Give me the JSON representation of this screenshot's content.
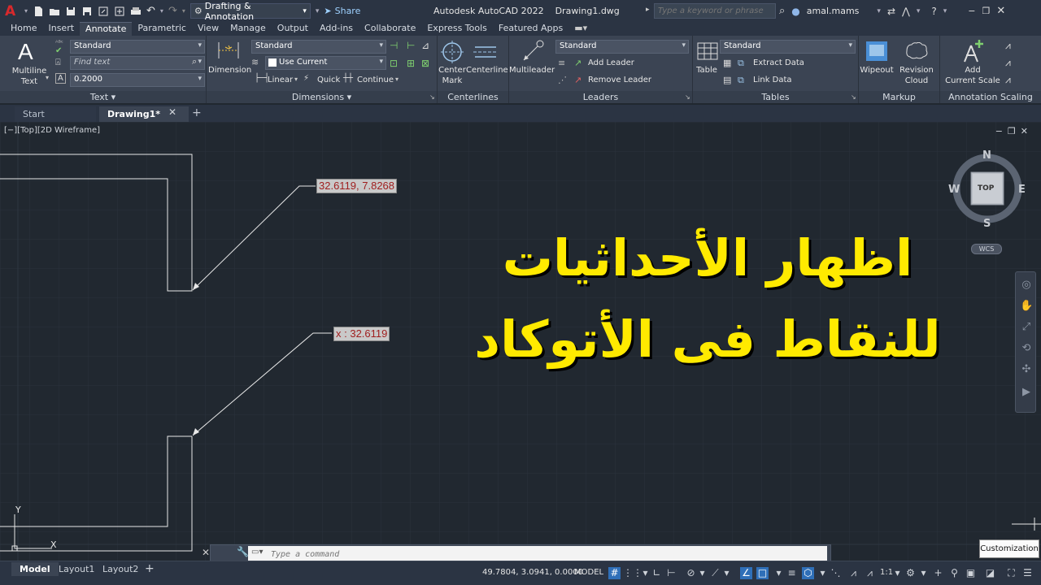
{
  "titlebar": {
    "workspace": "Drafting & Annotation",
    "share_label": "Share",
    "title": "Autodesk AutoCAD 2022    Drawing1.dwg",
    "search_placeholder": "Type a keyword or phrase",
    "user": "amal.mams"
  },
  "ribbon_tabs": [
    "Home",
    "Insert",
    "Annotate",
    "Parametric",
    "View",
    "Manage",
    "Output",
    "Add-ins",
    "Collaborate",
    "Express Tools",
    "Featured Apps"
  ],
  "ribbon_active_tab": "Annotate",
  "panels": {
    "text": {
      "title": "Text",
      "big_button": "Multiline\nText",
      "style": "Standard",
      "find_placeholder": "Find text",
      "height": "0.2000"
    },
    "dimensions": {
      "title": "Dimensions",
      "big_button": "Dimension",
      "style": "Standard",
      "layer": "Use Current",
      "linear": "Linear",
      "quick": "Quick",
      "continue": "Continue"
    },
    "centerlines": {
      "title": "Centerlines",
      "center_mark": "Center\nMark",
      "centerline": "Centerline"
    },
    "leaders": {
      "title": "Leaders",
      "big_button": "Multileader",
      "style": "Standard",
      "add": "Add Leader",
      "remove": "Remove Leader"
    },
    "tables": {
      "title": "Tables",
      "big_button": "Table",
      "style": "Standard",
      "extract": "Extract Data",
      "link": "Link Data"
    },
    "markup": {
      "title": "Markup",
      "wipeout": "Wipeout",
      "revision_cloud": "Revision\nCloud"
    },
    "annotation_scaling": {
      "title": "Annotation Scaling",
      "add_scale": "Add\nCurrent Scale"
    }
  },
  "doc_tabs": {
    "start": "Start",
    "drawing": "Drawing1*"
  },
  "canvas": {
    "viewport_label": "[−][Top][2D Wireframe]",
    "tag_xy": "32.6119, 7.8268",
    "tag_x": "x : 32.6119",
    "arabic_line1": "اظهار الأحداثيات",
    "arabic_line2": "للنقاط فى الأتوكاد",
    "viewcube": {
      "n": "N",
      "s": "S",
      "e": "E",
      "w": "W",
      "face": "TOP",
      "wcs": "WCS"
    },
    "ucs_y": "Y",
    "ucs_x": "X"
  },
  "command": {
    "placeholder": "Type a command"
  },
  "status": {
    "layout_tabs": [
      "Model",
      "Layout1",
      "Layout2"
    ],
    "coords": "49.7804, 3.0941, 0.0000",
    "space": "MODEL",
    "scale": "1:1",
    "tooltip": "Customization"
  },
  "colors": {
    "canvas_bg": "#212830",
    "ribbon_bg": "#3b4453",
    "arabic_text": "#ffea00",
    "tag_text": "#a02020"
  }
}
